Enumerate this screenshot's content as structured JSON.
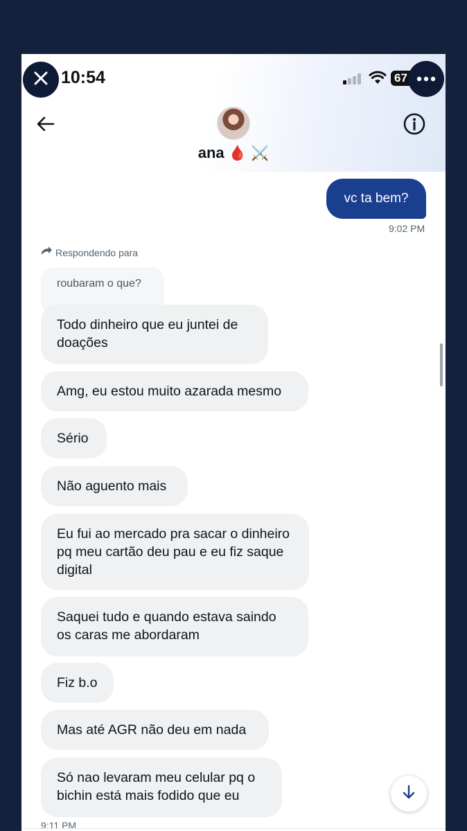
{
  "status_bar": {
    "time": "10:54",
    "battery": "67"
  },
  "header": {
    "contact_name": "ana",
    "name_emoji_drop": "🩸",
    "name_emoji_swords": "⚔️"
  },
  "messages": {
    "outgoing": {
      "text": "vc ta bem?",
      "time": "9:02 PM"
    },
    "reply_label": "Respondendo para",
    "quoted_text": "roubaram o que?",
    "incoming": [
      {
        "text": "Todo dinheiro que eu juntei de doações"
      },
      {
        "text": "Amg, eu estou muito azarada mesmo"
      },
      {
        "text": "Sério"
      },
      {
        "text": "Não aguento mais"
      },
      {
        "text": "Eu fui ao mercado pra sacar o dinheiro pq meu cartão deu pau e eu fiz saque digital"
      },
      {
        "text": "Saquei tudo e quando estava saindo os caras me abordaram"
      },
      {
        "text": "Fiz b.o"
      },
      {
        "text": "Mas até AGR não deu em nada"
      },
      {
        "text": "Só nao levaram meu celular pq o bichin está mais fodido que eu"
      }
    ],
    "incoming_time": "9:11 PM"
  },
  "colors": {
    "page_background": "#14213d",
    "outgoing_bubble": "#1a3f8f",
    "incoming_bubble": "#eff1f3",
    "overlay_buttons": "#0e1a36"
  },
  "icons": [
    "close-icon",
    "more-icon",
    "signal-icon",
    "wifi-icon",
    "battery-icon",
    "back-arrow-icon",
    "info-icon",
    "reply-arrow-icon",
    "arrow-down-icon"
  ]
}
